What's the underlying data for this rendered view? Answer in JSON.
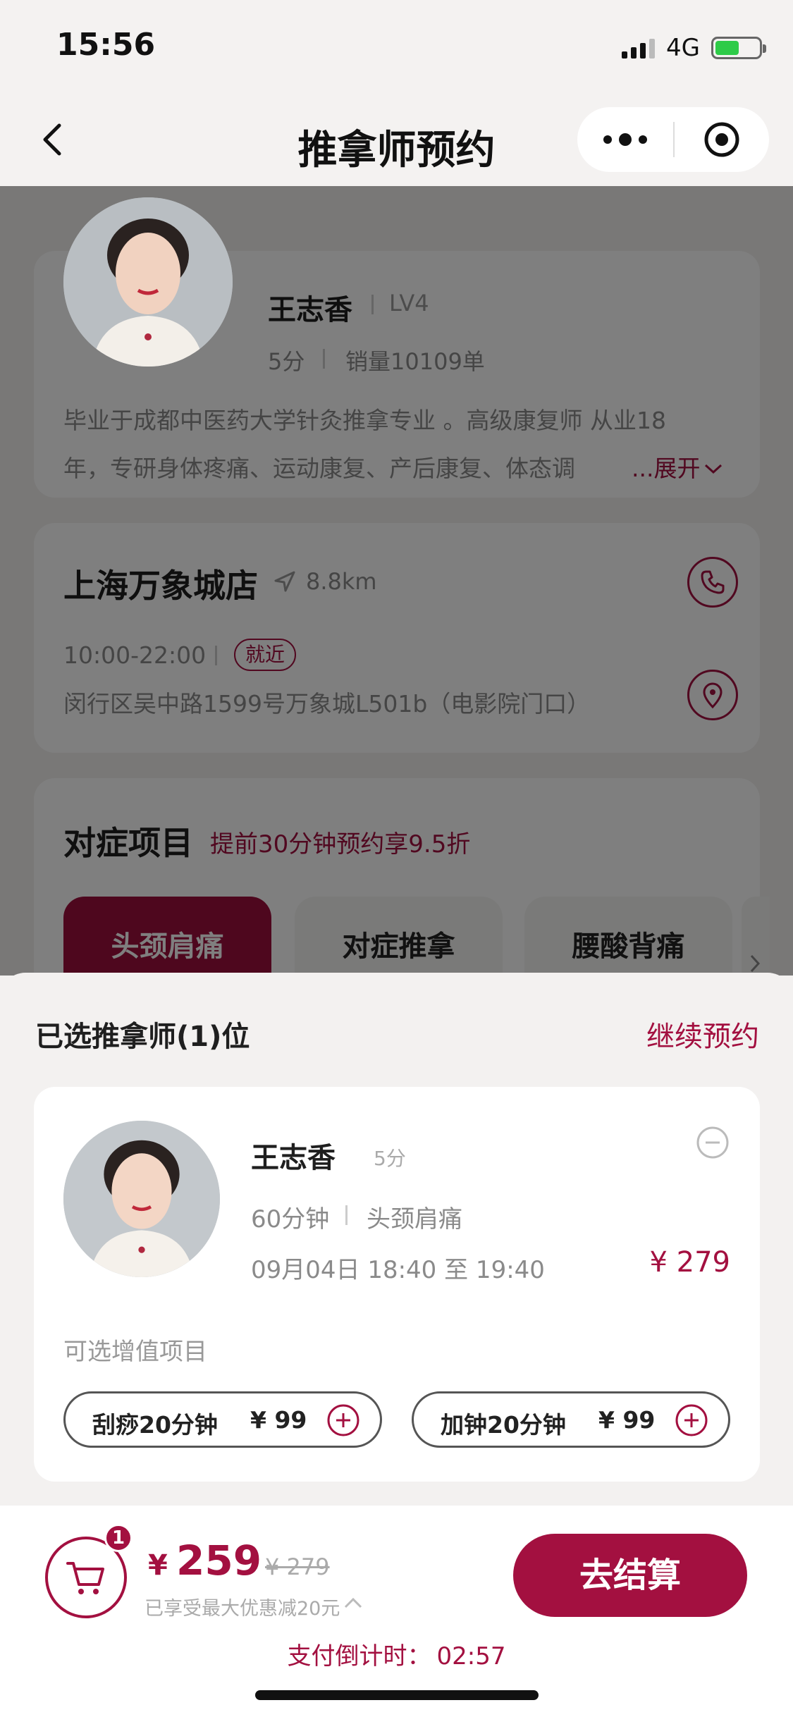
{
  "status": {
    "time": "15:56",
    "network": "4G"
  },
  "nav": {
    "title": "推拿师预约"
  },
  "therapist": {
    "name": "王志香",
    "level": "LV4",
    "score": "5分",
    "sales": "销量10109单",
    "desc_line1": "毕业于成都中医药大学针灸推拿专业 。高级康复师 从业18",
    "desc_line2": "年，专研身体疼痛、运动康复、产后康复、体态调",
    "expand": "...展开"
  },
  "store": {
    "name": "上海万象城店",
    "distance": "8.8km",
    "hours": "10:00-22:00",
    "badge": "就近",
    "address": "闵行区吴中路1599号万象城L501b（电影院门口）"
  },
  "items": {
    "title": "对症项目",
    "promo": "提前30分钟预约享9.5折",
    "tabs": [
      "头颈肩痛",
      "对症推拿",
      "腰酸背痛"
    ]
  },
  "sheet": {
    "title": "已选推拿师(1)位",
    "continue": "继续预约",
    "selection": {
      "name": "王志香",
      "score": "5分",
      "duration": "60分钟",
      "project": "头颈肩痛",
      "time": "09月04日 18:40 至 19:40",
      "price": "¥ 279"
    },
    "addon_label": "可选增值项目",
    "addons": [
      {
        "name": "刮痧20分钟",
        "price": "¥ 99"
      },
      {
        "name": "加钟20分钟",
        "price": "¥ 99"
      }
    ]
  },
  "footer": {
    "cart_count": "1",
    "currency": "¥",
    "total": "259",
    "original": "¥ 279",
    "discount": "已享受最大优惠减20元",
    "checkout": "去结算",
    "countdown_label": "支付倒计时：",
    "countdown_value": "02:57"
  },
  "colors": {
    "accent": "#a31040",
    "background": "#f3f1f0"
  },
  "icons": [
    "back-icon",
    "more-icon",
    "close-mini-program-icon",
    "navigation-arrow-icon",
    "phone-icon",
    "location-icon",
    "chevron-right-icon",
    "remove-icon",
    "plus-icon",
    "cart-icon",
    "chevron-up-icon"
  ]
}
